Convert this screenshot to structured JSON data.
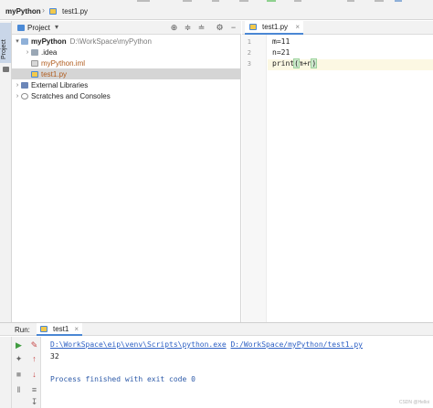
{
  "breadcrumb": {
    "project": "myPython",
    "file": "test1.py"
  },
  "sidebar": {
    "project_tab": "Project"
  },
  "project_panel": {
    "title": "Project",
    "tree": [
      {
        "name": "myPython",
        "path": "D:\\WorkSpace\\myPython",
        "icon": "folder-icon",
        "expanded": true
      },
      {
        "name": ".idea",
        "icon": "folder-icon",
        "expanded": false
      },
      {
        "name": "myPython.iml",
        "icon": "iml-file-icon"
      },
      {
        "name": "test1.py",
        "icon": "python-file-icon",
        "selected": true
      },
      {
        "name": "External Libraries",
        "icon": "libraries-icon",
        "expanded": false
      },
      {
        "name": "Scratches and Consoles",
        "icon": "scratch-icon",
        "expanded": false
      }
    ]
  },
  "editor": {
    "tab": "test1.py",
    "lines": [
      {
        "no": "1",
        "code": "m=11"
      },
      {
        "no": "2",
        "code": "n=21"
      },
      {
        "no": "3",
        "code_pre": "print",
        "code_open": "(",
        "code_mid": "m+n",
        "code_close": ")"
      }
    ]
  },
  "run": {
    "label": "Run:",
    "tab": "test1",
    "output": {
      "command_exe": "D:\\WorkSpace\\eip\\venv\\Scripts\\python.exe",
      "command_script": "D:/WorkSpace/myPython/test1.py",
      "result": "32",
      "finish": "Process finished with exit code 0"
    }
  },
  "watermark": "CSDN @Helloi",
  "colors": {
    "accent": "#4a87d4",
    "link": "#2d60c4",
    "selected_row": "#d5d5d5",
    "run_green": "#3f9b3f",
    "stop_red": "#c74646"
  }
}
